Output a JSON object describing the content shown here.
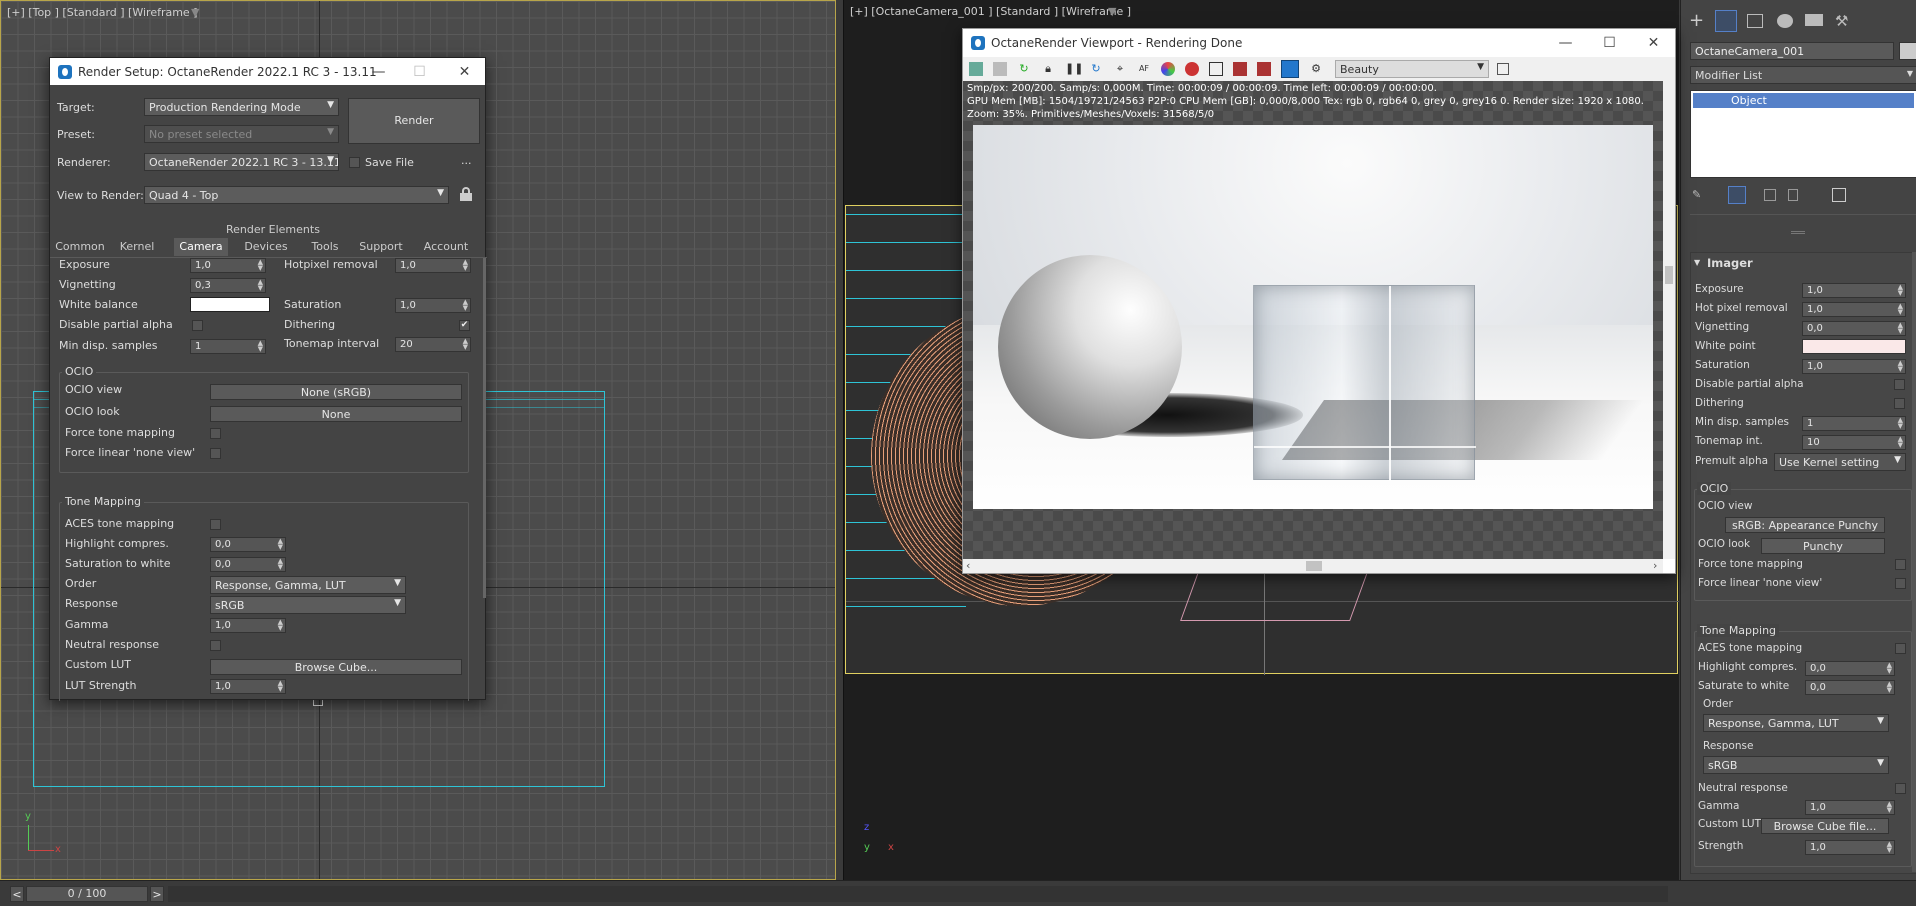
{
  "viewport_top": {
    "label": "[+] [Top ] [Standard ] [Wireframe ]",
    "axis_x": "x",
    "axis_y": "y"
  },
  "viewport_camera": {
    "label": "[+] [OctaneCamera_001 ] [Standard ] [Wireframe ]",
    "axis_x": "x",
    "axis_y": "y",
    "axis_z": "z"
  },
  "timeline": {
    "prev": "<",
    "next": ">",
    "frame": "0 / 100"
  },
  "render_setup": {
    "title": "Render Setup: OctaneRender 2022.1 RC 3 - 13.11",
    "target_label": "Target:",
    "target_value": "Production Rendering Mode",
    "preset_label": "Preset:",
    "preset_value": "No preset selected",
    "renderer_label": "Renderer:",
    "renderer_value": "OctaneRender 2022.1 RC 3 - 13.11",
    "save_file": "Save File",
    "more": "...",
    "view_label": "View to Render:",
    "view_value": "Quad 4 - Top",
    "render_button": "Render",
    "render_elements": "Render Elements",
    "tabs": [
      "Common",
      "Kernel",
      "Camera",
      "Devices",
      "Tools",
      "Support",
      "Account"
    ],
    "exposure": {
      "label": "Exposure",
      "value": "1,0"
    },
    "hotpixel": {
      "label": "Hotpixel removal",
      "value": "1,0"
    },
    "vignetting": {
      "label": "Vignetting",
      "value": "0,3"
    },
    "white_balance": {
      "label": "White balance"
    },
    "saturation": {
      "label": "Saturation",
      "value": "1,0"
    },
    "disable_partial_alpha": "Disable partial alpha",
    "dithering": "Dithering",
    "min_disp": {
      "label": "Min disp. samples",
      "value": "1"
    },
    "tonemap_interval": {
      "label": "Tonemap interval",
      "value": "20"
    },
    "ocio": {
      "title": "OCIO",
      "view_label": "OCIO view",
      "view_value": "None (sRGB)",
      "look_label": "OCIO look",
      "look_value": "None",
      "force_tone": "Force tone mapping",
      "force_linear": "Force linear 'none view'"
    },
    "tone": {
      "title": "Tone Mapping",
      "aces": "ACES tone mapping",
      "highlight_label": "Highlight compres.",
      "highlight_value": "0,0",
      "sat_white_label": "Saturation to white",
      "sat_white_value": "0,0",
      "order_label": "Order",
      "order_value": "Response, Gamma, LUT",
      "response_label": "Response",
      "response_value": "sRGB",
      "gamma_label": "Gamma",
      "gamma_value": "1,0",
      "neutral": "Neutral response",
      "custom_lut_label": "Custom LUT",
      "custom_lut_button": "Browse Cube...",
      "lut_strength_label": "LUT Strength",
      "lut_strength_value": "1,0"
    }
  },
  "octane_viewport": {
    "title": "OctaneRender Viewport - Rendering Done",
    "pass_value": "Beauty",
    "stats1": "Smp/px: 200/200.   Samp/s: 0,000M.   Time: 00:00:09 / 00:00:09.   Time left: 00:00:09 / 00:00:00.",
    "stats2": "GPU Mem [MB]: 1504/19721/24563 P2P:0   CPU Mem [GB]: 0,000/8,000   Tex: rgb 0, rgb64 0, grey 0, grey16 0.   Render size: 1920 x 1080.",
    "stats3": "Zoom: 35%.   Primitives/Meshes/Voxels: 31568/5/0"
  },
  "command_panel": {
    "object_name": "OctaneCamera_001",
    "modifier_list": "Modifier List",
    "stack_item": "Object",
    "rollout_title": "Imager",
    "rows": [
      {
        "label": "Exposure",
        "value": "1,0"
      },
      {
        "label": "Hot pixel removal",
        "value": "1,0"
      },
      {
        "label": "Vignetting",
        "value": "0,0"
      }
    ],
    "white_point": "White point",
    "saturation": {
      "label": "Saturation",
      "value": "1,0"
    },
    "disable_partial_alpha": "Disable partial alpha",
    "dithering": "Dithering",
    "min_disp": {
      "label": "Min disp. samples",
      "value": "1"
    },
    "tonemap": {
      "label": "Tonemap int.",
      "value": "10"
    },
    "premult": {
      "label": "Premult alpha",
      "value": "Use Kernel setting"
    },
    "ocio": {
      "title": "OCIO",
      "view_label": "OCIO view",
      "view_value": "sRGB: Appearance Punchy",
      "look_label": "OCIO look",
      "look_value": "Punchy",
      "force_tone": "Force tone mapping",
      "force_linear": "Force linear 'none view'"
    },
    "tone": {
      "title": "Tone Mapping",
      "aces": "ACES tone mapping",
      "highlight_label": "Highlight compres.",
      "highlight_value": "0,0",
      "sat_white_label": "Saturate to white",
      "sat_white_value": "0,0",
      "order_label": "Order",
      "order_value": "Response, Gamma, LUT",
      "response_label": "Response",
      "response_value": "sRGB",
      "neutral": "Neutral response",
      "gamma_label": "Gamma",
      "gamma_value": "1,0",
      "custom_lut_label": "Custom LUT",
      "custom_lut_button": "Browse Cube file...",
      "strength_label": "Strength",
      "strength_value": "1,0"
    }
  },
  "colors": {
    "accent": "#1e73be",
    "selection": "#5580c8",
    "wire_cyan": "#2ec4d6",
    "wire_orange": "#e8a07a"
  }
}
